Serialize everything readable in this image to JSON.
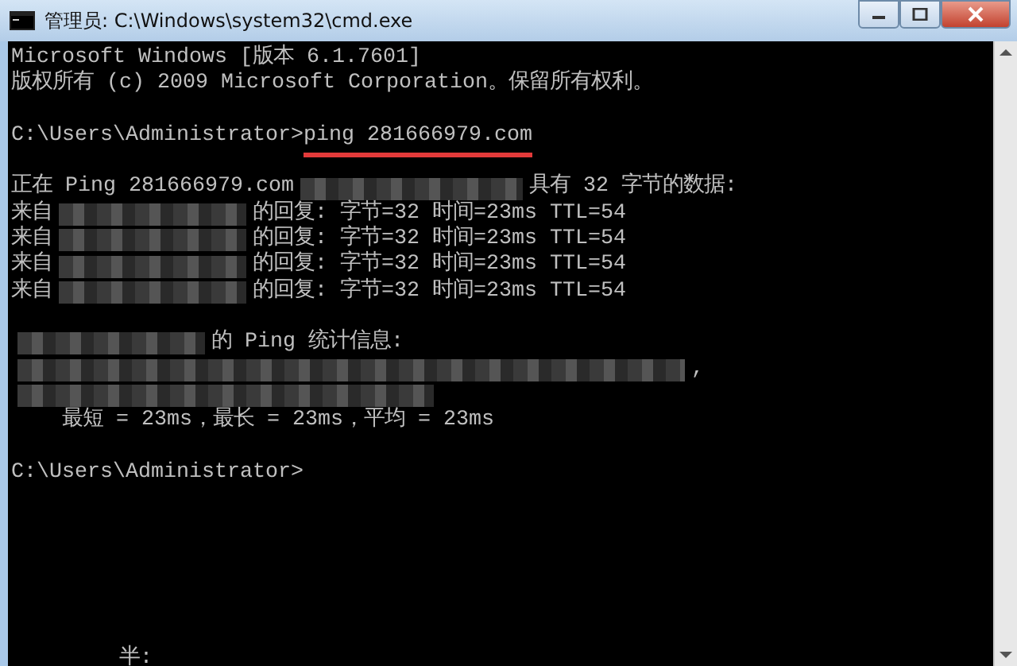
{
  "window": {
    "title": "管理员: C:\\Windows\\system32\\cmd.exe"
  },
  "console": {
    "blocks": [
      [
        [
          {
            "kind": "text",
            "text": "Microsoft Windows [版本 6.1.7601]"
          }
        ],
        [
          {
            "kind": "text",
            "text": "版权所有 (c) 2009 Microsoft Corporation。保留所有权利。"
          }
        ]
      ],
      [
        [
          {
            "kind": "text",
            "text": "C:\\Users\\Administrator>"
          },
          {
            "kind": "marked",
            "text": "ping 281666979.com"
          }
        ]
      ],
      [
        [
          {
            "kind": "text",
            "text": "正在 Ping 281666979.com"
          },
          {
            "kind": "redacted"
          },
          {
            "kind": "text",
            "text": "具有 32 字节的数据:"
          }
        ],
        [
          {
            "kind": "text",
            "text": "来自"
          },
          {
            "kind": "redacted"
          },
          {
            "kind": "text",
            "text": "的回复: 字节=32 时间=23ms TTL=54"
          }
        ],
        [
          {
            "kind": "text",
            "text": "来自"
          },
          {
            "kind": "redacted"
          },
          {
            "kind": "text",
            "text": "的回复: 字节=32 时间=23ms TTL=54"
          }
        ],
        [
          {
            "kind": "text",
            "text": "来自"
          },
          {
            "kind": "redacted"
          },
          {
            "kind": "text",
            "text": "的回复: 字节=32 时间=23ms TTL=54"
          }
        ],
        [
          {
            "kind": "text",
            "text": "来自"
          },
          {
            "kind": "redacted"
          },
          {
            "kind": "text",
            "text": "的回复: 字节=32 时间=23ms TTL=54"
          }
        ]
      ],
      [
        [
          {
            "kind": "redacted"
          },
          {
            "kind": "text",
            "text": "的 Ping 统计信息:"
          }
        ],
        [
          {
            "kind": "redacted"
          },
          {
            "kind": "text",
            "text": ","
          }
        ],
        [
          {
            "kind": "redacted"
          }
        ],
        [
          {
            "kind": "text",
            "text": "    最短 = 23ms，最长 = 23ms，平均 = 23ms"
          }
        ]
      ],
      [
        [
          {
            "kind": "text",
            "text": "C:\\Users\\Administrator>"
          }
        ]
      ]
    ],
    "bottom_text": "半:"
  }
}
